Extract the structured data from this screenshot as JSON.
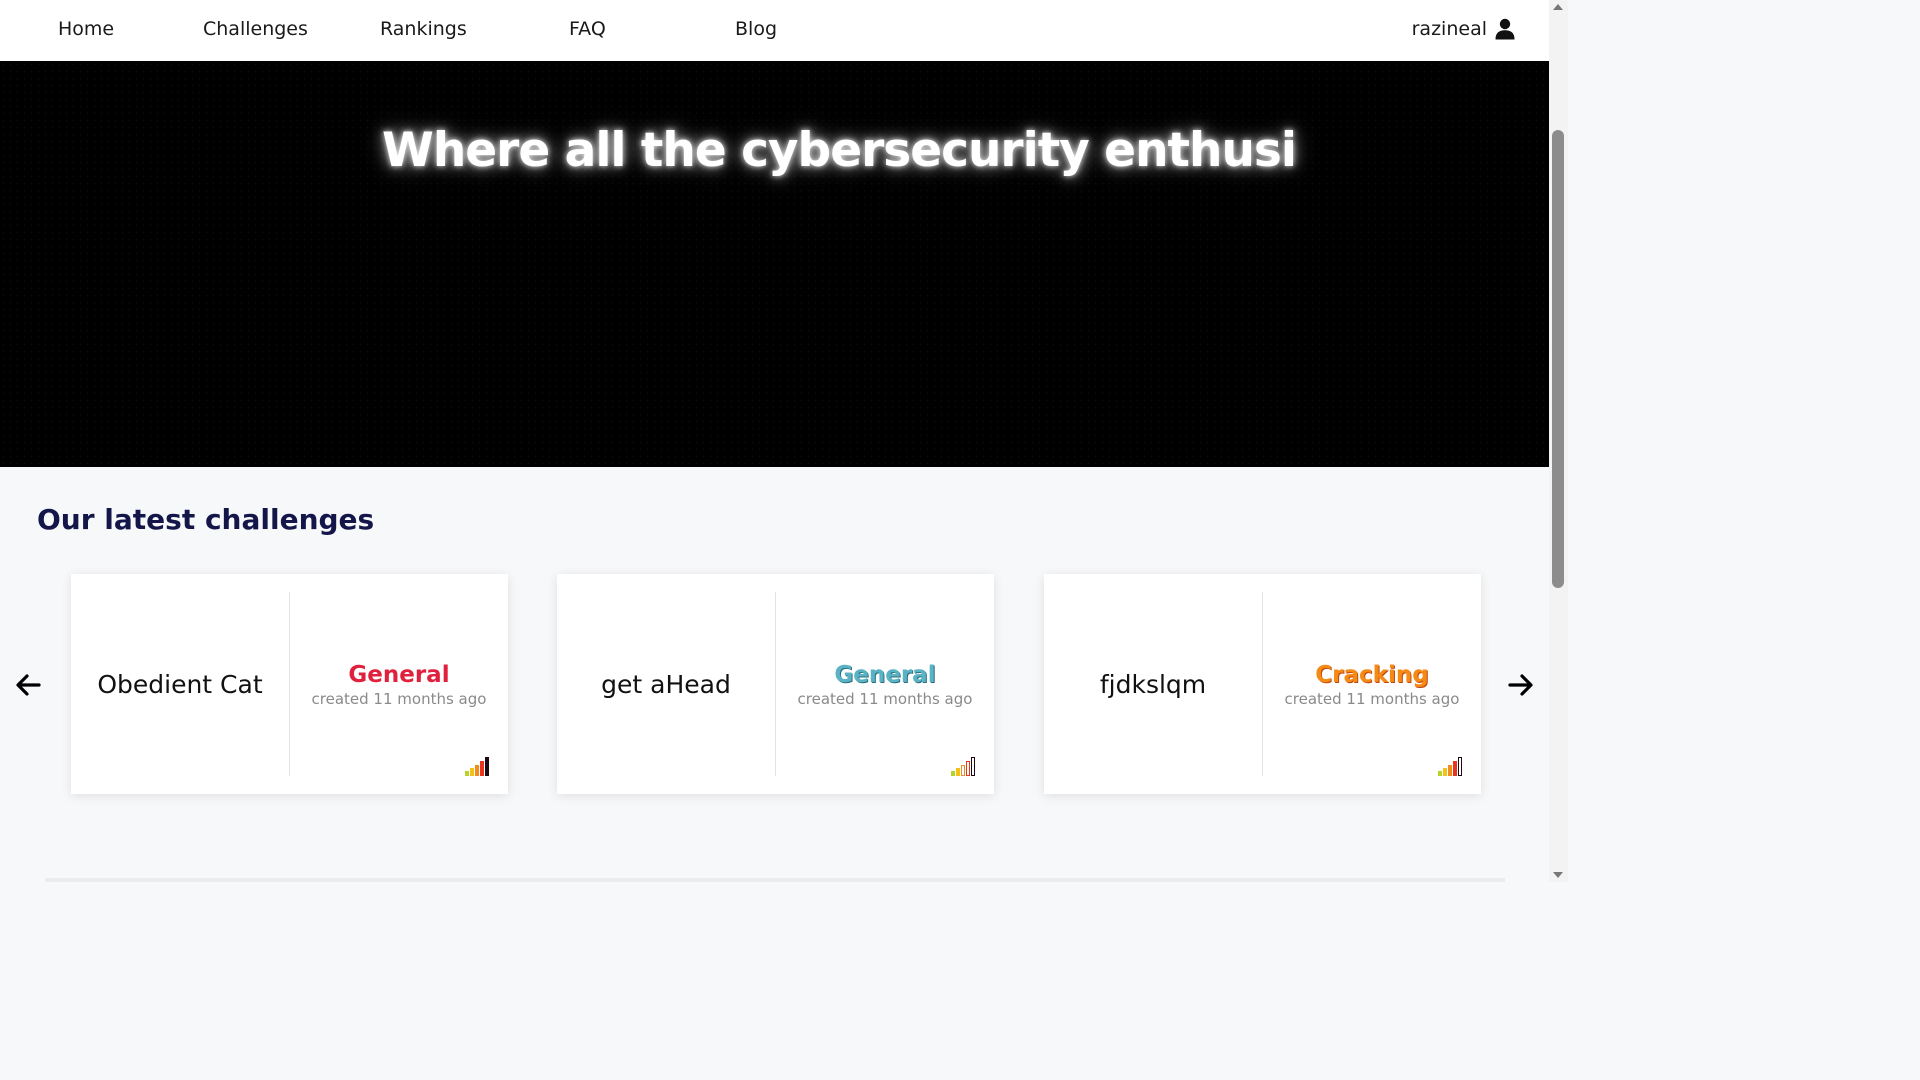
{
  "nav": {
    "items": [
      "Home",
      "Challenges",
      "Rankings",
      "FAQ",
      "Blog"
    ],
    "username": "razineal",
    "user_icon": "user-icon"
  },
  "hero": {
    "title": "Where all the cybersecurity enthusi"
  },
  "latest": {
    "title": "Our latest challenges",
    "cards": [
      {
        "name": "Obedient Cat",
        "category": "General",
        "category_color": "#e0213e",
        "created": "created 11 months ago",
        "difficulty": 5
      },
      {
        "name": "get aHead",
        "category": "General",
        "category_color": "#5ab3c4",
        "created": "created 11 months ago",
        "difficulty": 2
      },
      {
        "name": "fjdkslqm",
        "category": "Cracking",
        "category_color": "#f58a14",
        "created": "created 11 months ago",
        "difficulty": 4
      }
    ],
    "prev_icon": "arrow-left-icon",
    "next_icon": "arrow-right-icon"
  },
  "colors": {
    "difficulty_bars": [
      "#b6d32a",
      "#f2c21b",
      "#f28c1c",
      "#e8351f",
      "#1c0b12"
    ]
  }
}
